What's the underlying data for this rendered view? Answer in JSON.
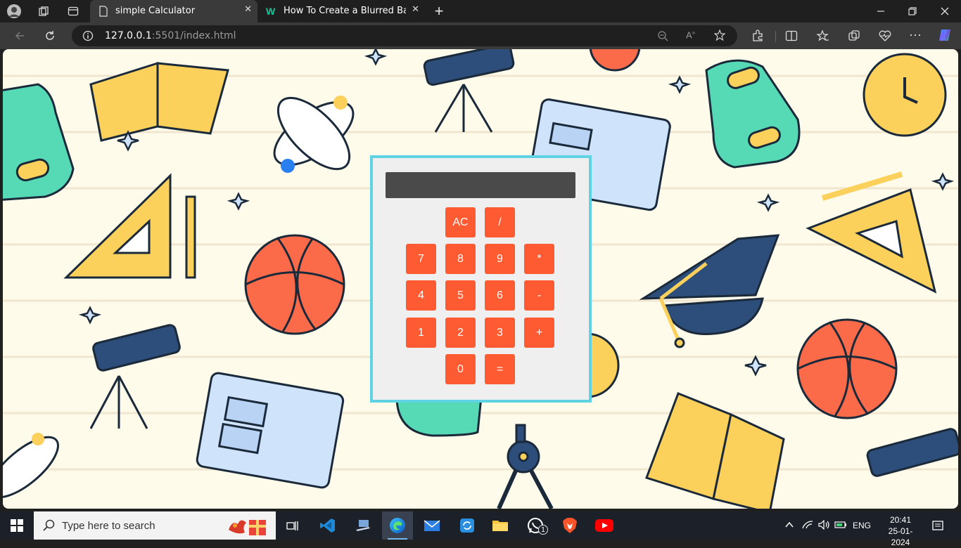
{
  "browser": {
    "tabs": [
      {
        "title": "simple Calculator",
        "icon": "page-icon",
        "active": true
      },
      {
        "title": "How To Create a Blurred Backgro",
        "icon": "w-logo-icon",
        "active": false
      }
    ],
    "new_tab_label": "+",
    "url_host": "127.0.0.1",
    "url_rest": ":5501/index.html"
  },
  "calculator": {
    "display_value": "",
    "keys": [
      {
        "label": "AC",
        "name": "clear"
      },
      {
        "label": "/",
        "name": "divide"
      },
      {
        "label": "7",
        "name": "7"
      },
      {
        "label": "8",
        "name": "8"
      },
      {
        "label": "9",
        "name": "9"
      },
      {
        "label": "*",
        "name": "multiply"
      },
      {
        "label": "4",
        "name": "4"
      },
      {
        "label": "5",
        "name": "5"
      },
      {
        "label": "6",
        "name": "6"
      },
      {
        "label": "-",
        "name": "subtract"
      },
      {
        "label": "1",
        "name": "1"
      },
      {
        "label": "2",
        "name": "2"
      },
      {
        "label": "3",
        "name": "3"
      },
      {
        "label": "+",
        "name": "add"
      },
      {
        "label": "0",
        "name": "0"
      },
      {
        "label": "=",
        "name": "equals"
      }
    ],
    "colors": {
      "key": "#ff5b32",
      "border": "#5fd3e4",
      "display": "#4a4a4a",
      "body": "#efefef"
    }
  },
  "taskbar": {
    "search_placeholder": "Type here to search",
    "apps": [
      "task-view-icon",
      "vscode-icon",
      "laptop-icon",
      "edge-icon",
      "mail-icon",
      "sync-icon",
      "file-explorer-icon",
      "whatsapp-icon",
      "brave-icon",
      "youtube-icon"
    ],
    "whatsapp_badge": "1",
    "language": "ENG",
    "time": "20:41",
    "date": "25-01-2024"
  }
}
